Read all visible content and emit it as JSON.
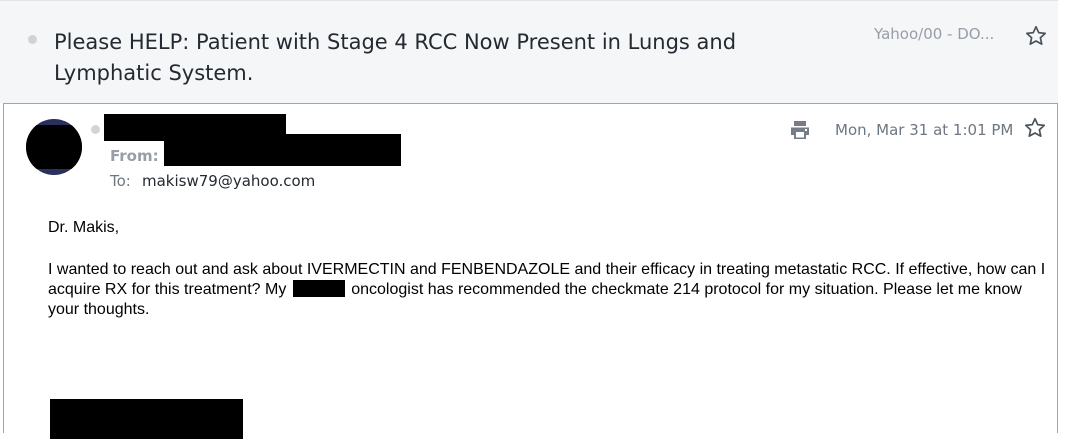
{
  "thread": {
    "subject": "Please HELP: Patient with Stage 4 RCC Now Present in Lungs and Lymphatic System.",
    "folder": "Yahoo/00 - DO..."
  },
  "message": {
    "from_label": "From:",
    "to_label": "To:",
    "to_address": "makisw79@yahoo.com",
    "date": "Mon, Mar 31 at 1:01 PM",
    "greeting": "Dr. Makis,",
    "body_before_redaction": "I wanted to reach out and ask about IVERMECTIN and FENBENDAZOLE and their efficacy in treating metastatic RCC. If effective, how can I acquire RX for this treatment? My",
    "body_after_redaction": "oncologist has recommended the checkmate 214 protocol for my situation. Please let me know your thoughts."
  },
  "icons": {
    "star": "star-outline-icon",
    "print": "printer-icon",
    "unread": "dot-icon"
  },
  "colors": {
    "header_background": "#f5f6f7",
    "muted_text": "#979ea8",
    "card_border": "#9da5ad",
    "redaction": "#000000"
  }
}
